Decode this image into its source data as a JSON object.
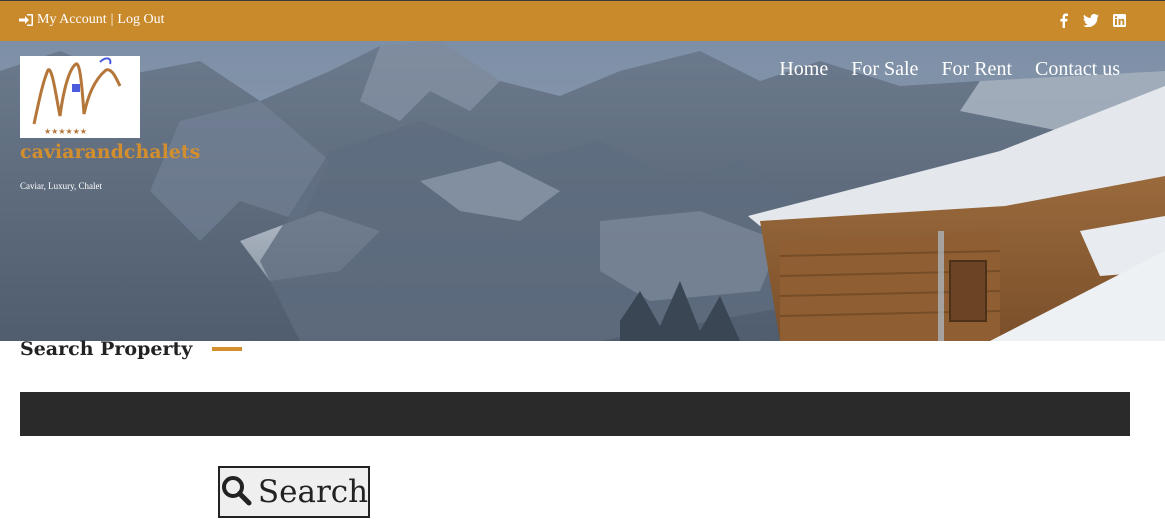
{
  "topbar": {
    "my_account": "My Account",
    "separator": "|",
    "log_out": "Log Out",
    "login_icon": "sign-in-icon",
    "social": [
      "facebook-icon",
      "twitter-icon",
      "linkedin-icon"
    ],
    "color": "#c98a2c"
  },
  "header": {
    "site_title": "caviarandchalets",
    "tagline": "Caviar, Luxury, Chalet",
    "logo_stars": "★★★★★★",
    "nav": [
      "Home",
      "For Sale",
      "For Rent",
      "Contact us"
    ]
  },
  "search": {
    "heading": "Search Property",
    "button_label": "Search",
    "button_icon": "search-icon"
  },
  "colors": {
    "accent": "#d38f2e",
    "dark_strip": "#2a2a2a"
  }
}
